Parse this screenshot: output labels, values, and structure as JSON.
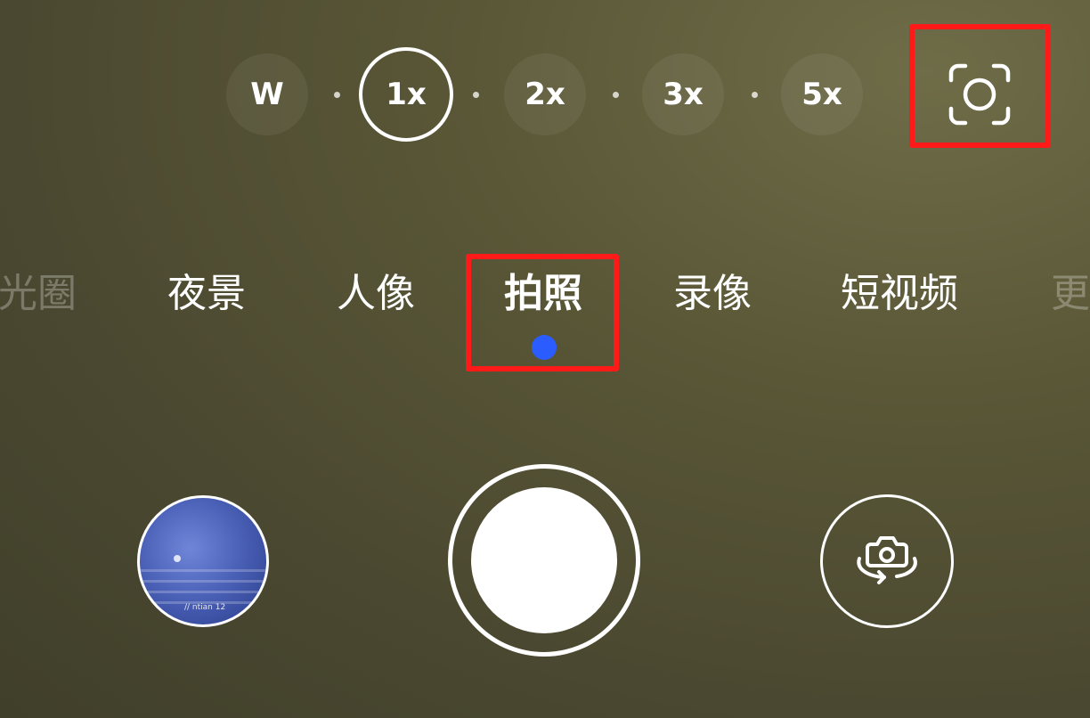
{
  "zoom": {
    "levels": [
      {
        "label": "W",
        "active": false
      },
      {
        "label": "1x",
        "active": true
      },
      {
        "label": "2x",
        "active": false
      },
      {
        "label": "3x",
        "active": false
      },
      {
        "label": "5x",
        "active": false
      }
    ]
  },
  "modes": {
    "items": [
      {
        "label": "光圈",
        "active": false
      },
      {
        "label": "夜景",
        "active": false
      },
      {
        "label": "人像",
        "active": false
      },
      {
        "label": "拍照",
        "active": true
      },
      {
        "label": "录像",
        "active": false
      },
      {
        "label": "短视频",
        "active": false
      },
      {
        "label": "更",
        "active": false
      }
    ],
    "indicator_color": "#2b5cff"
  },
  "gallery_thumbnail": {
    "caption": "// ntian 12"
  },
  "icons": {
    "lens_focus": "lens-focus-icon",
    "switch_camera": "switch-camera-icon"
  },
  "colors": {
    "annotation": "#ff1a1a",
    "accent": "#2b5cff",
    "background": "#55533a"
  }
}
